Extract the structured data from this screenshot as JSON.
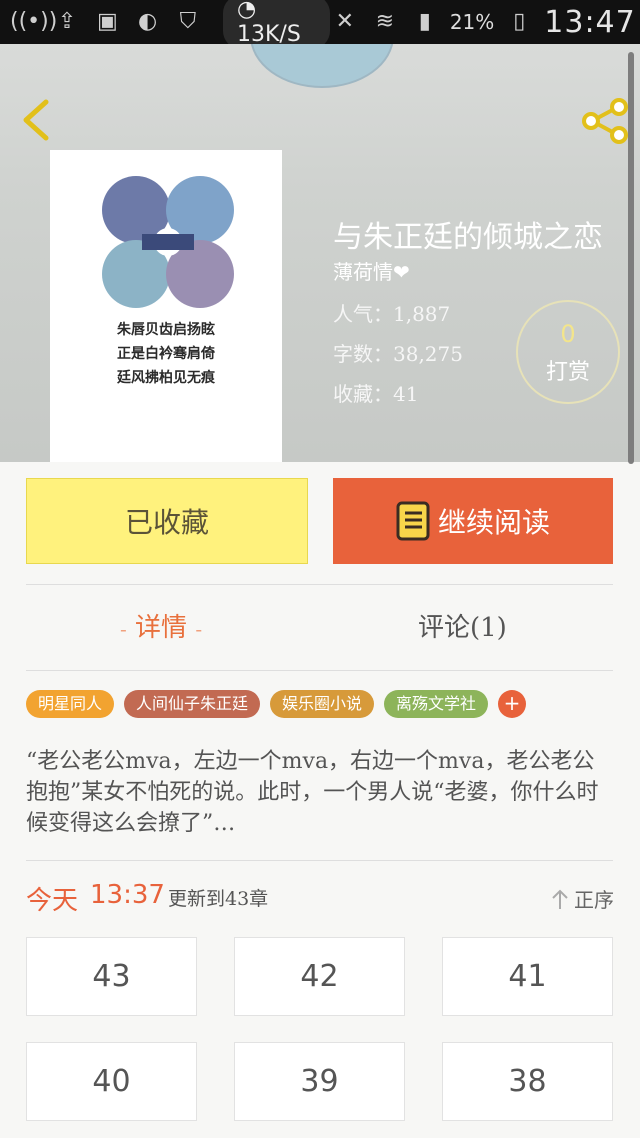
{
  "status_bar": {
    "speed": "13K/S",
    "battery": "21%",
    "time": "13:47"
  },
  "book": {
    "title": "与朱正廷的倾城之恋",
    "author": "薄荷情❤",
    "stats": [
      {
        "label": "人气：",
        "value": "1,887"
      },
      {
        "label": "字数：",
        "value": "38,275"
      },
      {
        "label": "收藏：",
        "value": "41"
      }
    ],
    "cover_lines": [
      "朱唇贝齿启扬眩",
      "正是白衿骞肩倚",
      "廷风拂柏见无痕"
    ],
    "tip_count": "0",
    "tip_label": "打赏"
  },
  "actions": {
    "collected_label": "已收藏",
    "read_label": "继续阅读"
  },
  "tabs": {
    "detail_label": "详情",
    "comments_label": "评论(1)"
  },
  "tags": [
    {
      "label": "明星同人",
      "color": "#f2a330"
    },
    {
      "label": "人间仙子朱正廷",
      "color": "#c26a52"
    },
    {
      "label": "娱乐圈小说",
      "color": "#d79a3a"
    },
    {
      "label": "离殇文学社",
      "color": "#8db45a"
    }
  ],
  "tag_add_label": "+",
  "synopsis": "“老公老公mva，左边一个mva，右边一个mva，老公老公抱抱”某女不怕死的说。此时，一个男人说“老婆，你什么时候变得这么会撩了”…",
  "update": {
    "day": "今天",
    "time": "13:37",
    "chapter_text": "更新到43章",
    "sort_label": "正序"
  },
  "chapters": [
    "43",
    "42",
    "41",
    "40",
    "39",
    "38"
  ],
  "colors": {
    "accent": "#e8623b",
    "collected_bg": "#fff27d"
  }
}
